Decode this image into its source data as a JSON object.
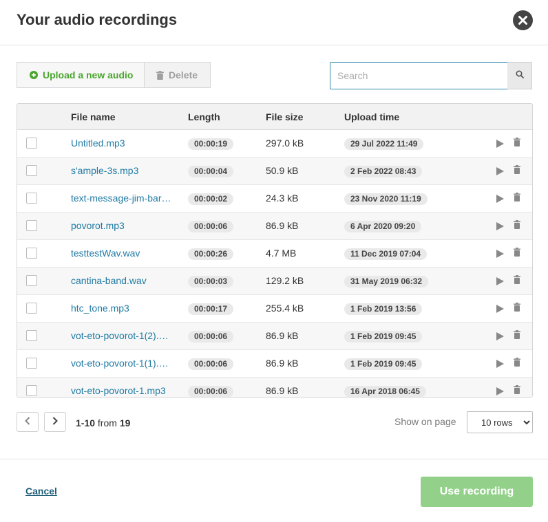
{
  "dialog": {
    "title": "Your audio recordings"
  },
  "toolbar": {
    "upload_label": "Upload a new audio",
    "delete_label": "Delete"
  },
  "search": {
    "placeholder": "Search",
    "value": ""
  },
  "table": {
    "columns": {
      "name": "File name",
      "length": "Length",
      "size": "File size",
      "upload": "Upload time"
    },
    "rows": [
      {
        "name": "Untitled.mp3",
        "length": "00:00:19",
        "size": "297.0 kB",
        "upload": "29 Jul 2022 11:49"
      },
      {
        "name": "s'ample-3s.mp3",
        "length": "00:00:04",
        "size": "50.9 kB",
        "upload": "2 Feb 2022 08:43"
      },
      {
        "name": "text-message-jim-bar…",
        "length": "00:00:02",
        "size": "24.3 kB",
        "upload": "23 Nov 2020 11:19"
      },
      {
        "name": "povorot.mp3",
        "length": "00:00:06",
        "size": "86.9 kB",
        "upload": "6 Apr 2020 09:20"
      },
      {
        "name": "testtestWav.wav",
        "length": "00:00:26",
        "size": "4.7 MB",
        "upload": "11 Dec 2019 07:04"
      },
      {
        "name": "cantina-band.wav",
        "length": "00:00:03",
        "size": "129.2 kB",
        "upload": "31 May 2019 06:32"
      },
      {
        "name": "htc_tone.mp3",
        "length": "00:00:17",
        "size": "255.4 kB",
        "upload": "1 Feb 2019 13:56"
      },
      {
        "name": "vot-eto-povorot-1(2).…",
        "length": "00:00:06",
        "size": "86.9 kB",
        "upload": "1 Feb 2019 09:45"
      },
      {
        "name": "vot-eto-povorot-1(1).…",
        "length": "00:00:06",
        "size": "86.9 kB",
        "upload": "1 Feb 2019 09:45"
      },
      {
        "name": "vot-eto-povorot-1.mp3",
        "length": "00:00:06",
        "size": "86.9 kB",
        "upload": "16 Apr 2018 06:45"
      }
    ]
  },
  "pagination": {
    "range": "1-10",
    "from_label": "from",
    "total": "19",
    "show_label": "Show on page",
    "rows_option": "10 rows"
  },
  "footer": {
    "cancel_label": "Cancel",
    "use_label": "Use recording"
  },
  "colors": {
    "accent_green": "#4aa52e",
    "link_blue": "#1f7aa3",
    "use_button": "#93d18a"
  },
  "icons": [
    "close-icon",
    "plus-circle-icon",
    "trash-icon",
    "search-icon",
    "play-icon",
    "chevron-left-icon",
    "chevron-right-icon"
  ]
}
